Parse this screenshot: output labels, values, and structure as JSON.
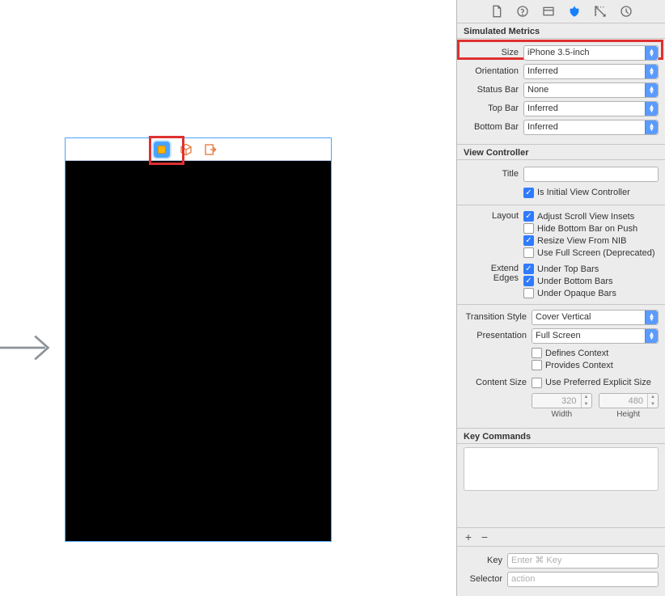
{
  "simulated_metrics": {
    "header": "Simulated Metrics",
    "size_label": "Size",
    "size_value": "iPhone 3.5-inch",
    "orientation_label": "Orientation",
    "orientation_value": "Inferred",
    "status_bar_label": "Status Bar",
    "status_bar_value": "None",
    "top_bar_label": "Top Bar",
    "top_bar_value": "Inferred",
    "bottom_bar_label": "Bottom Bar",
    "bottom_bar_value": "Inferred"
  },
  "view_controller": {
    "header": "View Controller",
    "title_label": "Title",
    "title_value": "",
    "is_initial": {
      "label": "Is Initial View Controller",
      "checked": true
    },
    "layout_label": "Layout",
    "layout": [
      {
        "label": "Adjust Scroll View Insets",
        "checked": true
      },
      {
        "label": "Hide Bottom Bar on Push",
        "checked": false
      },
      {
        "label": "Resize View From NIB",
        "checked": true
      },
      {
        "label": "Use Full Screen (Deprecated)",
        "checked": false
      }
    ],
    "extend_edges_label": "Extend Edges",
    "extend_edges": [
      {
        "label": "Under Top Bars",
        "checked": true
      },
      {
        "label": "Under Bottom Bars",
        "checked": true
      },
      {
        "label": "Under Opaque Bars",
        "checked": false
      }
    ],
    "transition_style_label": "Transition Style",
    "transition_style_value": "Cover Vertical",
    "presentation_label": "Presentation",
    "presentation_value": "Full Screen",
    "defines_context": {
      "label": "Defines Context",
      "checked": false
    },
    "provides_context": {
      "label": "Provides Context",
      "checked": false
    },
    "content_size_label": "Content Size",
    "use_preferred": {
      "label": "Use Preferred Explicit Size",
      "checked": false
    },
    "width_value": "320",
    "width_label": "Width",
    "height_value": "480",
    "height_label": "Height"
  },
  "key_commands": {
    "header": "Key Commands",
    "key_label": "Key",
    "key_placeholder": "Enter ⌘ Key",
    "selector_label": "Selector",
    "selector_placeholder": "action"
  },
  "icons": {
    "plus": "+",
    "minus": "−"
  }
}
